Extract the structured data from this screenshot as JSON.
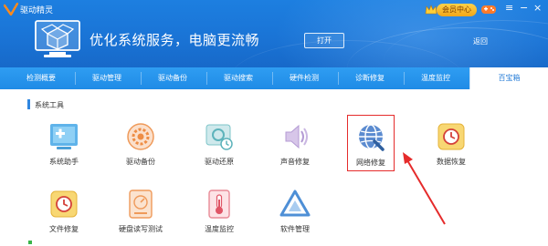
{
  "app": {
    "title": "驱动精灵"
  },
  "titlebar": {
    "vip_label": "会员中心"
  },
  "banner": {
    "slogan": "优化系统服务，电脑更流畅",
    "open_label": "打开",
    "back_label": "返回"
  },
  "tabs": [
    {
      "label": "检测概要",
      "active": false
    },
    {
      "label": "驱动管理",
      "active": false
    },
    {
      "label": "驱动备份",
      "active": false
    },
    {
      "label": "驱动搜索",
      "active": false
    },
    {
      "label": "硬件检测",
      "active": false
    },
    {
      "label": "诊断修复",
      "active": false
    },
    {
      "label": "温度监控",
      "active": false
    },
    {
      "label": "百宝箱",
      "active": true
    }
  ],
  "section": {
    "title": "系统工具"
  },
  "tools": [
    {
      "label": "系统助手",
      "icon": "system-assistant-icon"
    },
    {
      "label": "驱动备份",
      "icon": "driver-backup-icon"
    },
    {
      "label": "驱动还原",
      "icon": "driver-restore-icon"
    },
    {
      "label": "声音修复",
      "icon": "sound-repair-icon"
    },
    {
      "label": "网络修复",
      "icon": "network-repair-icon",
      "highlighted": true
    },
    {
      "label": "数据恢复",
      "icon": "data-recovery-icon"
    },
    {
      "label": "文件修复",
      "icon": "file-repair-icon"
    },
    {
      "label": "硬盘读写测试",
      "icon": "disk-test-icon"
    },
    {
      "label": "温度监控",
      "icon": "temperature-icon"
    },
    {
      "label": "软件管理",
      "icon": "software-manager-icon"
    }
  ],
  "colors": {
    "header_blue": "#1a74d6",
    "tab_blue": "#2f9df2",
    "highlight_red": "#e52b2b",
    "accent": "#2f86e0"
  }
}
